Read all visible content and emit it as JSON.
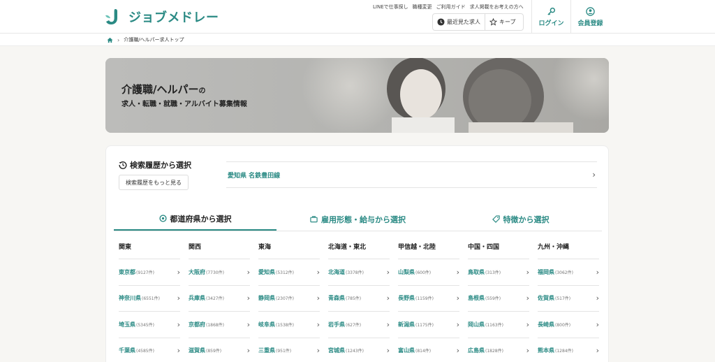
{
  "header": {
    "logo_text": "ジョブメドレー",
    "top_links": [
      "LINEで仕事探し",
      "職種変更",
      "ご利用ガイド",
      "求人掲載をお考えの方へ"
    ],
    "recent_label": "最近見た求人",
    "keep_label": "キープ",
    "login_label": "ログイン",
    "register_label": "会員登録"
  },
  "breadcrumb": {
    "current": "介護職/ヘルパー求人トップ"
  },
  "hero": {
    "title_main": "介護職/ヘルパー",
    "title_suffix": "の",
    "subtitle": "求人・転職・就職・アルバイト募集情報"
  },
  "history": {
    "title": "検索履歴から選択",
    "more_label": "検索履歴をもっと見る",
    "item": "愛知県 名鉄豊田線"
  },
  "tabs": [
    {
      "label": "都道府県から選択",
      "icon": "map-pin-icon",
      "active": true
    },
    {
      "label": "雇用形態・給与から選択",
      "icon": "briefcase-icon",
      "active": false
    },
    {
      "label": "特徴から選択",
      "icon": "tag-icon",
      "active": false
    }
  ],
  "regions": [
    {
      "name": "関東",
      "prefs": [
        {
          "name": "東京都",
          "count": "(9127件)"
        },
        {
          "name": "神奈川県",
          "count": "(6551件)"
        },
        {
          "name": "埼玉県",
          "count": "(5345件)"
        },
        {
          "name": "千葉県",
          "count": "(4585件)"
        }
      ]
    },
    {
      "name": "関西",
      "prefs": [
        {
          "name": "大阪府",
          "count": "(7730件)"
        },
        {
          "name": "兵庫県",
          "count": "(3427件)"
        },
        {
          "name": "京都府",
          "count": "(1868件)"
        },
        {
          "name": "滋賀県",
          "count": "(859件)"
        }
      ]
    },
    {
      "name": "東海",
      "prefs": [
        {
          "name": "愛知県",
          "count": "(5312件)"
        },
        {
          "name": "静岡県",
          "count": "(2307件)"
        },
        {
          "name": "岐阜県",
          "count": "(1538件)"
        },
        {
          "name": "三重県",
          "count": "(951件)"
        }
      ]
    },
    {
      "name": "北海道・東北",
      "prefs": [
        {
          "name": "北海道",
          "count": "(3378件)"
        },
        {
          "name": "青森県",
          "count": "(785件)"
        },
        {
          "name": "岩手県",
          "count": "(627件)"
        },
        {
          "name": "宮城県",
          "count": "(1243件)"
        }
      ]
    },
    {
      "name": "甲信越・北陸",
      "prefs": [
        {
          "name": "山梨県",
          "count": "(600件)"
        },
        {
          "name": "長野県",
          "count": "(1159件)"
        },
        {
          "name": "新潟県",
          "count": "(1175件)"
        },
        {
          "name": "富山県",
          "count": "(814件)"
        }
      ]
    },
    {
      "name": "中国・四国",
      "prefs": [
        {
          "name": "鳥取県",
          "count": "(313件)"
        },
        {
          "name": "島根県",
          "count": "(559件)"
        },
        {
          "name": "岡山県",
          "count": "(1163件)"
        },
        {
          "name": "広島県",
          "count": "(1828件)"
        }
      ]
    },
    {
      "name": "九州・沖縄",
      "prefs": [
        {
          "name": "福岡県",
          "count": "(3062件)"
        },
        {
          "name": "佐賀県",
          "count": "(517件)"
        },
        {
          "name": "長崎県",
          "count": "(800件)"
        },
        {
          "name": "熊本県",
          "count": "(1284件)"
        }
      ]
    }
  ],
  "colors": {
    "brand": "#2a8a84",
    "background": "#f7f6f3"
  }
}
